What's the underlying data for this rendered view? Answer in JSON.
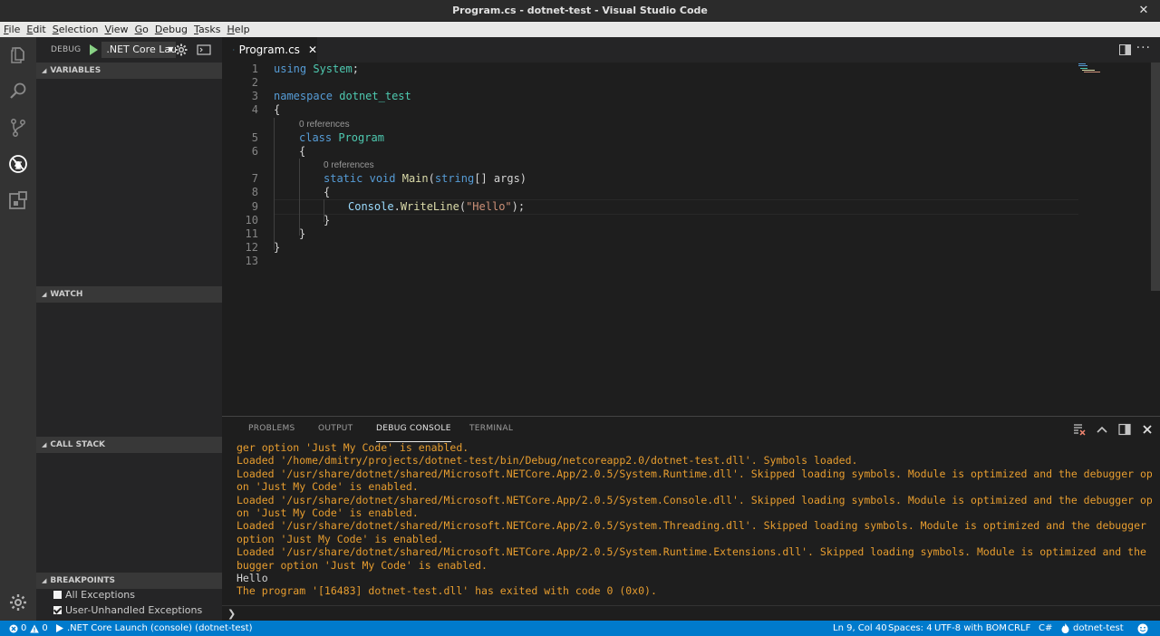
{
  "window": {
    "title": "Program.cs - dotnet-test - Visual Studio Code"
  },
  "menu": [
    {
      "u": "F",
      "rest": "ile"
    },
    {
      "u": "E",
      "rest": "dit"
    },
    {
      "u": "S",
      "rest": "election"
    },
    {
      "u": "V",
      "rest": "iew"
    },
    {
      "u": "G",
      "rest": "o"
    },
    {
      "u": "D",
      "rest": "ebug"
    },
    {
      "u": "T",
      "rest": "asks"
    },
    {
      "u": "H",
      "rest": "elp"
    }
  ],
  "sidebar": {
    "debug_label": "DEBUG",
    "config": ".NET Core Lau",
    "sections": {
      "variables": "VARIABLES",
      "watch": "WATCH",
      "call_stack": "CALL STACK",
      "breakpoints": "BREAKPOINTS"
    },
    "breakpoints": [
      {
        "label": "All Exceptions",
        "checked": false
      },
      {
        "label": "User-Unhandled Exceptions",
        "checked": true
      }
    ]
  },
  "editor": {
    "tab_label": "Program.cs",
    "line_numbers": [
      "1",
      "2",
      "3",
      "4",
      "5",
      "6",
      "7",
      "8",
      "9",
      "10",
      "11",
      "12",
      "13"
    ],
    "code": {
      "l1_kw": "using",
      "l1_ty": "System",
      "l1_p": ";",
      "l3_kw": "namespace",
      "l3_ty": "dotnet_test",
      "l4": "{",
      "lens1": "0 references",
      "l5_kw": "class",
      "l5_ty": "Program",
      "l6": "{",
      "lens2": "0 references",
      "l7_kw1": "static",
      "l7_kw2": "void",
      "l7_fn": "Main",
      "l7_p1": "(",
      "l7_kw3": "string",
      "l7_p2": "[] args)",
      "l8": "{",
      "l9_ty": "Console",
      "l9_p1": ".",
      "l9_fn": "WriteLine",
      "l9_p2": "(",
      "l9_st": "\"Hello\"",
      "l9_p3": ");",
      "l10": "}",
      "l11": "}",
      "l12": "}"
    }
  },
  "panel": {
    "tabs": [
      "PROBLEMS",
      "OUTPUT",
      "DEBUG CONSOLE",
      "TERMINAL"
    ],
    "console_lines": [
      {
        "cls": "info",
        "text": "ger option 'Just My Code' is enabled."
      },
      {
        "cls": "info",
        "text": "Loaded '/home/dmitry/projects/dotnet-test/bin/Debug/netcoreapp2.0/dotnet-test.dll'. Symbols loaded."
      },
      {
        "cls": "info",
        "text": "Loaded '/usr/share/dotnet/shared/Microsoft.NETCore.App/2.0.5/System.Runtime.dll'. Skipped loading symbols. Module is optimized and the debugger opti"
      },
      {
        "cls": "info",
        "text": "on 'Just My Code' is enabled."
      },
      {
        "cls": "info",
        "text": "Loaded '/usr/share/dotnet/shared/Microsoft.NETCore.App/2.0.5/System.Console.dll'. Skipped loading symbols. Module is optimized and the debugger opti"
      },
      {
        "cls": "info",
        "text": "on 'Just My Code' is enabled."
      },
      {
        "cls": "info",
        "text": "Loaded '/usr/share/dotnet/shared/Microsoft.NETCore.App/2.0.5/System.Threading.dll'. Skipped loading symbols. Module is optimized and the debugger op"
      },
      {
        "cls": "info",
        "text": "option 'Just My Code' is enabled."
      },
      {
        "cls": "info",
        "text": "Loaded '/usr/share/dotnet/shared/Microsoft.NETCore.App/2.0.5/System.Runtime.Extensions.dll'. Skipped loading symbols. Module is optimized and the de"
      },
      {
        "cls": "info",
        "text": "bugger option 'Just My Code' is enabled."
      },
      {
        "cls": "plain",
        "text": "Hello"
      },
      {
        "cls": "info",
        "text": "The program '[16483] dotnet-test.dll' has exited with code 0 (0x0)."
      }
    ],
    "prompt": "❯"
  },
  "statusbar": {
    "errors": "0",
    "warnings": "0",
    "launch": ".NET Core Launch (console) (dotnet-test)",
    "position": "Ln 9, Col 40",
    "spaces": "Spaces: 4",
    "encoding": "UTF-8 with BOM",
    "eol": "CRLF",
    "language": "C#",
    "project": "dotnet-test"
  },
  "colors": {
    "activity_bar": "#333333",
    "sidebar": "#252526",
    "editor": "#1e1e1e",
    "status_bar": "#007acc",
    "keyword": "#569cd6",
    "type": "#4ec9b0",
    "function": "#dcdcaa",
    "string": "#ce9178",
    "console_info": "#e79d2f"
  }
}
